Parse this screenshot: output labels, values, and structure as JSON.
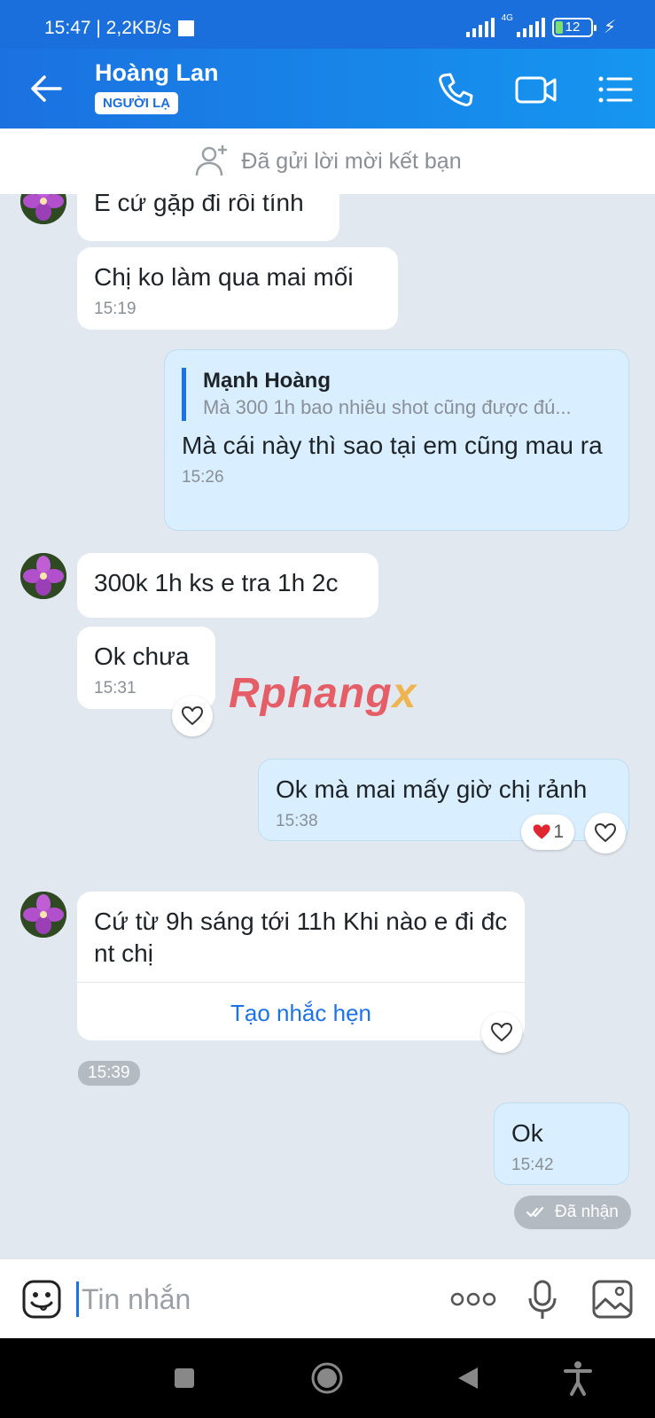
{
  "status_bar": {
    "time_speed": "15:47 | 2,2KB/s",
    "network": "4G",
    "battery": "12"
  },
  "header": {
    "name": "Hoàng Lan",
    "badge": "NGƯỜI LẠ"
  },
  "friend_request": {
    "text": "Đã gửi lời mời kết bạn"
  },
  "messages": [
    {
      "text": "E cứ gặp đi rồi tính"
    },
    {
      "text": "Chị ko làm qua mai mối",
      "time": "15:19"
    },
    {
      "reply_name": "Mạnh Hoàng",
      "reply_text": "Mà 300 1h bao nhiêu shot cũng được đú...",
      "text": "Mà cái này thì sao tại em cũng mau ra",
      "time": "15:26"
    },
    {
      "text": "300k 1h ks e tra 1h 2c"
    },
    {
      "text": "Ok chưa",
      "time": "15:31"
    },
    {
      "text": "Ok mà mai mấy giờ chị rảnh",
      "time": "15:38",
      "reaction_count": "1"
    },
    {
      "text": "Cứ từ 9h sáng tới 11h  Khi nào e đi đc nt chị",
      "action": "Tạo nhắc hẹn",
      "time": "15:39"
    },
    {
      "text": "Ok",
      "time": "15:42",
      "status": "Đã nhận"
    }
  ],
  "watermark": {
    "main": "Rphang",
    "x": "x"
  },
  "input": {
    "placeholder": "Tin nhắn"
  },
  "colors": {
    "header": "#1a6fdc",
    "bubble_mine": "#d9efff",
    "link": "#1a73e8",
    "chat_bg": "#e2e8ef"
  }
}
